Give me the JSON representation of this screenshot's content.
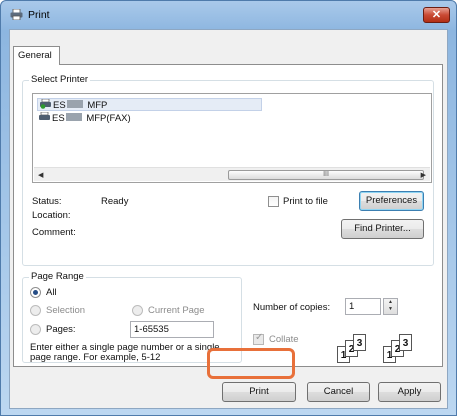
{
  "window": {
    "title": "Print",
    "close_glyph": "✕"
  },
  "tab": {
    "label": "General"
  },
  "select_printer": {
    "legend": "Select Printer",
    "printers": [
      {
        "prefix": "ES",
        "suffix": " MFP",
        "selected": true
      },
      {
        "prefix": "ES",
        "suffix": " MFP(FAX)",
        "selected": false
      }
    ],
    "scroll_left": "◀",
    "scroll_right": "▶",
    "thumb_grip": "III"
  },
  "status": {
    "status_label": "Status:",
    "status_value": "Ready",
    "location_label": "Location:",
    "comment_label": "Comment:"
  },
  "print_to_file": {
    "label": "Print to file"
  },
  "buttons": {
    "preferences": "Preferences",
    "find_printer": "Find Printer...",
    "print": "Print",
    "cancel": "Cancel",
    "apply": "Apply"
  },
  "page_range": {
    "legend": "Page Range",
    "all": "All",
    "selection": "Selection",
    "current_page": "Current Page",
    "pages": "Pages:",
    "pages_value": "1-65535",
    "hint": "Enter either a single page number or a single page range.  For example, 5-12",
    "selected_option": "All"
  },
  "copies": {
    "label": "Number of copies:",
    "value": "1",
    "collate": "Collate",
    "collate_checked": true
  }
}
